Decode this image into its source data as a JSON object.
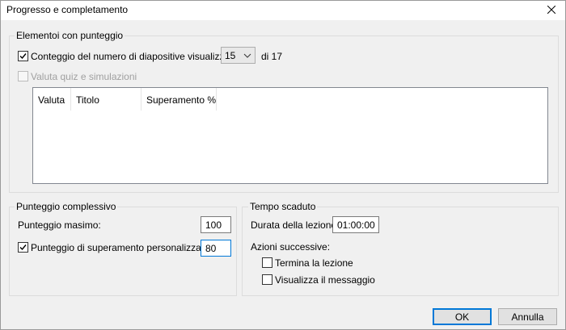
{
  "window": {
    "title": "Progresso e completamento",
    "close_icon": "close-icon"
  },
  "scored_items": {
    "group_label": "Elementoi con punteggio",
    "count_slides": {
      "checked": true,
      "label": "Conteggio del numero di diapositive visualizzate:",
      "selected_value": "15",
      "of_text": "di 17"
    },
    "quiz_sims": {
      "checked": false,
      "disabled": true,
      "label": "Valuta quiz e simulazioni"
    },
    "table": {
      "columns": [
        "Valuta",
        "Titolo",
        "Superamento %"
      ],
      "rows": []
    }
  },
  "overall_score": {
    "group_label": "Punteggio complessivo",
    "max_score_label": "Punteggio masimo:",
    "max_score_value": "100",
    "custom_pass": {
      "checked": true,
      "label": "Punteggio di superamento personalizzato:",
      "value": "80"
    }
  },
  "timeout": {
    "group_label": "Tempo scaduto",
    "duration_label": "Durata della lezione:",
    "duration_value": "01:00:00",
    "next_actions_label": "Azioni successive:",
    "end_lesson": {
      "checked": false,
      "label": "Termina la lezione"
    },
    "show_message": {
      "checked": false,
      "label": "Visualizza il messaggio"
    }
  },
  "footer": {
    "ok_label": "OK",
    "cancel_label": "Annulla"
  },
  "colors": {
    "accent": "#0078d7",
    "dialog_bg": "#f0f0f0"
  }
}
